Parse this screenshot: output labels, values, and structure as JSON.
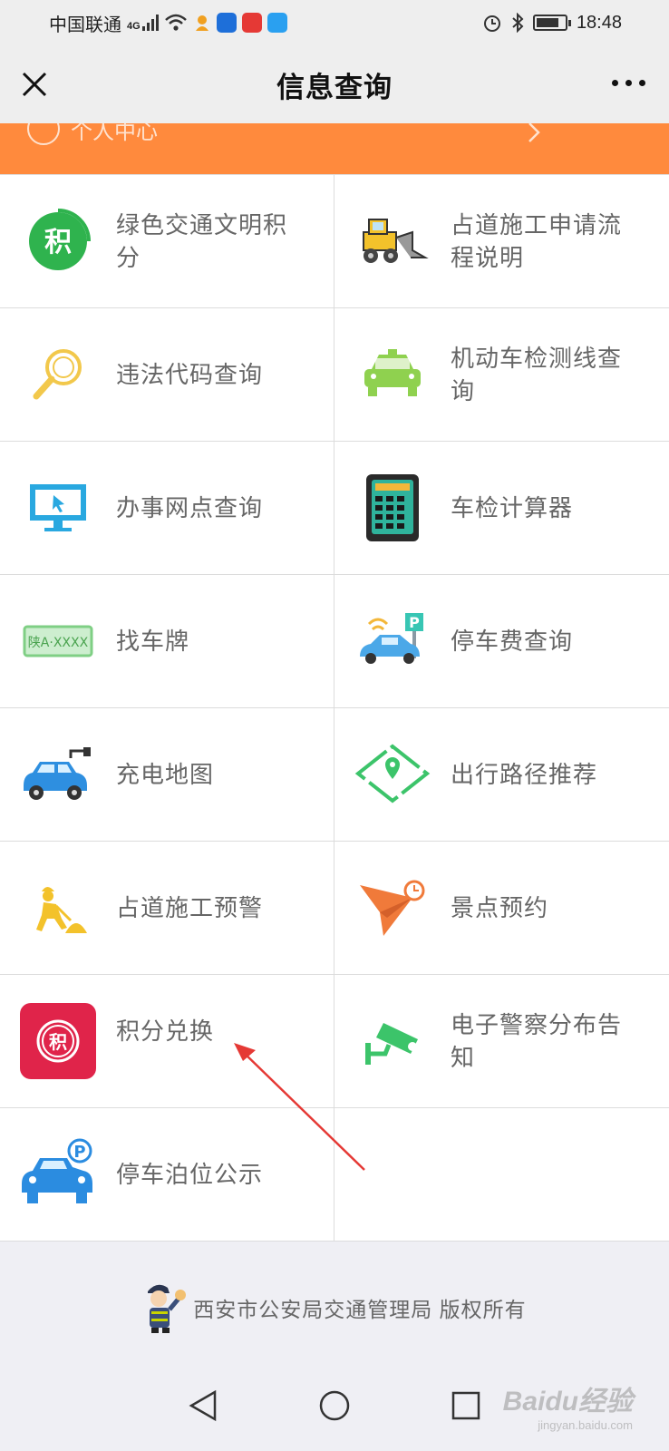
{
  "status_bar": {
    "carrier": "中国联通",
    "network": "4G",
    "time": "18:48",
    "icons": [
      "signal-icon",
      "wifi-icon",
      "app-notification-icon",
      "alarm-icon",
      "bluetooth-icon",
      "battery-icon"
    ]
  },
  "nav": {
    "title": "信息查询",
    "close_icon": "close-icon",
    "more_icon": "more-icon"
  },
  "header_strip": {
    "label": "个人中心",
    "color": "#ff8a3d"
  },
  "grid_items": [
    {
      "label": "绿色交通文明积分",
      "icon": "green-points-icon"
    },
    {
      "label": "占道施工申请流程说明",
      "icon": "bulldozer-icon"
    },
    {
      "label": "违法代码查询",
      "icon": "magnifier-icon"
    },
    {
      "label": "机动车检测线查询",
      "icon": "green-car-icon"
    },
    {
      "label": "办事网点查询",
      "icon": "monitor-icon"
    },
    {
      "label": "车检计算器",
      "icon": "calculator-icon"
    },
    {
      "label": "找车牌",
      "icon": "license-plate-icon"
    },
    {
      "label": "停车费查询",
      "icon": "parking-car-icon"
    },
    {
      "label": "充电地图",
      "icon": "charging-car-icon"
    },
    {
      "label": "出行路径推荐",
      "icon": "route-icon"
    },
    {
      "label": "占道施工预警",
      "icon": "construction-worker-icon"
    },
    {
      "label": "景点预约",
      "icon": "paper-plane-clock-icon"
    },
    {
      "label": "积分兑换",
      "icon": "points-exchange-icon"
    },
    {
      "label": "电子警察分布告知",
      "icon": "camera-icon"
    },
    {
      "label": "停车泊位公示",
      "icon": "parking-berth-icon"
    }
  ],
  "plate_text": "陕A·XXXX",
  "points_glyph": "积",
  "parking_glyph": "P",
  "footer": {
    "text": "西安市公安局交通管理局 版权所有",
    "mascot_icon": "police-mascot-icon"
  },
  "watermark": {
    "text": "Baidu经验",
    "sub": "jingyan.baidu.com"
  },
  "colors": {
    "accent": "#ff8a3d",
    "arrow": "#e53935"
  }
}
